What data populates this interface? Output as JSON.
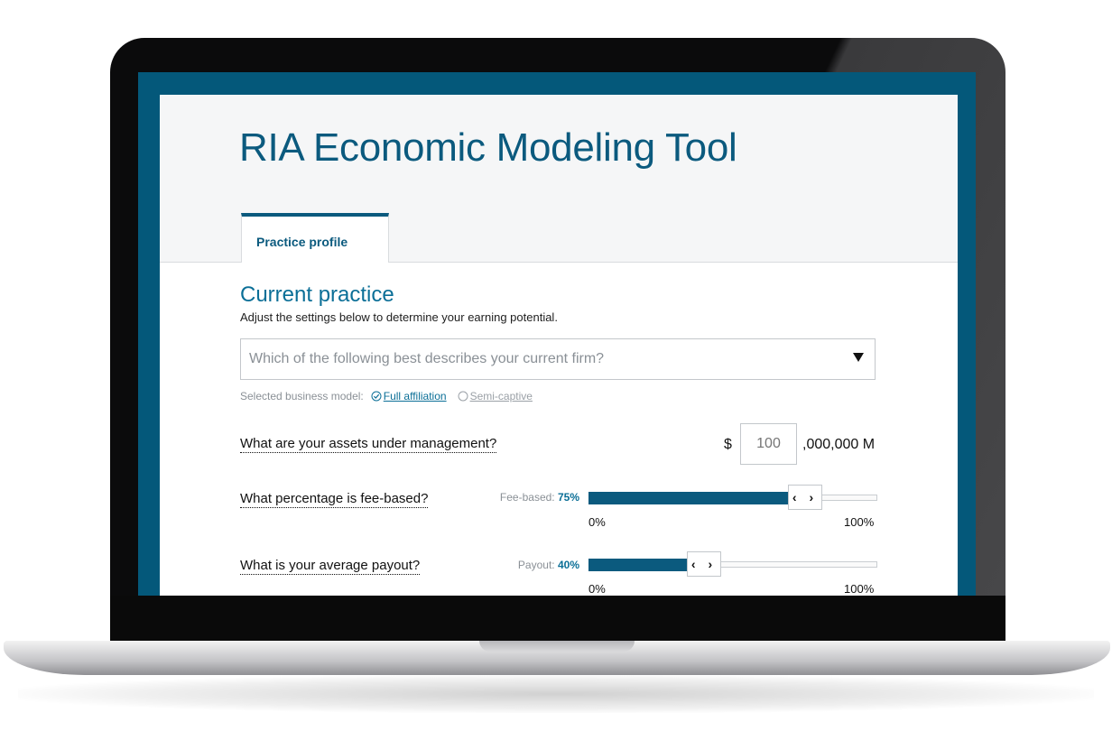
{
  "app": {
    "title": "RIA Economic Modeling Tool",
    "accent_color": "#0b5a7e",
    "tabs": [
      {
        "label": "Practice profile",
        "active": true
      }
    ]
  },
  "section": {
    "title": "Current practice",
    "subtitle": "Adjust the settings below to determine your earning potential."
  },
  "firm_select": {
    "placeholder": "Which of the following best describes your current firm?",
    "icon": "caret-down-icon"
  },
  "business_model": {
    "label": "Selected business model:",
    "options": [
      {
        "label": "Full affiliation",
        "selected": true,
        "icon": "check-circle-icon"
      },
      {
        "label": "Semi-captive",
        "selected": false,
        "icon": "empty-circle-icon"
      }
    ]
  },
  "aum": {
    "question": "What are your assets under management?",
    "currency": "$",
    "placeholder": "100",
    "suffix": ",000,000 M"
  },
  "fee_based": {
    "question": "What percentage is fee-based?",
    "label": "Fee-based:",
    "value_text": "75%",
    "value": 75,
    "min_label": "0%",
    "max_label": "100%",
    "handle_glyphs": "‹ ›"
  },
  "payout": {
    "question": "What is your average payout?",
    "label": "Payout:",
    "value_text": "40%",
    "value": 40,
    "min_label": "0%",
    "max_label": "100%",
    "handle_glyphs": "‹ ›"
  }
}
